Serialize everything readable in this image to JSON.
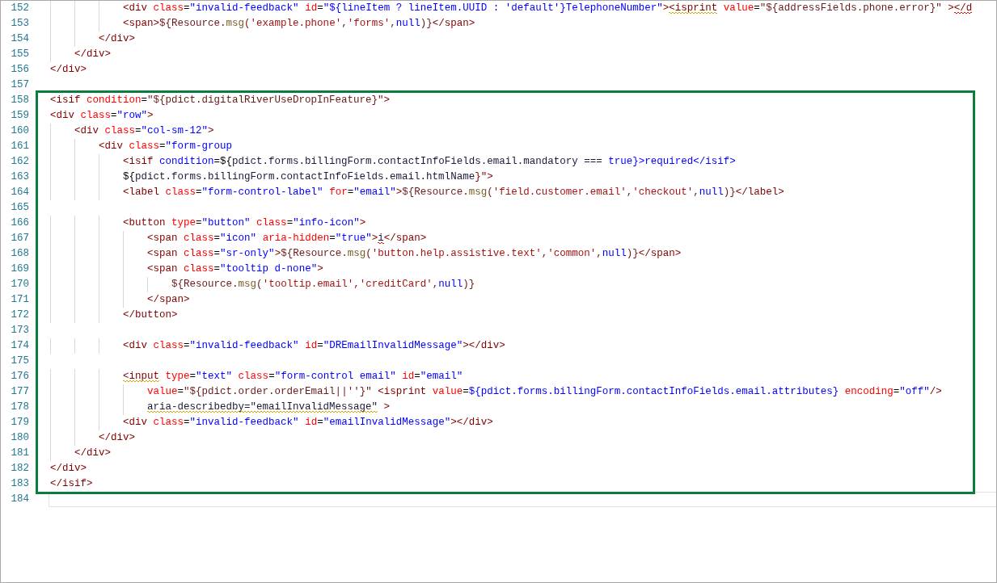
{
  "editor": {
    "groups": [
      {
        "highlighted": false,
        "lines": [
          {
            "number": "152",
            "current": false,
            "tokens": [
              {
                "kind": "tag",
                "text": "            <div"
              },
              {
                "kind": "attr",
                "text": " class"
              },
              {
                "kind": "punct",
                "text": "="
              },
              {
                "kind": "value",
                "text": "\"invalid-feedback\""
              },
              {
                "kind": "attr",
                "text": " id"
              },
              {
                "kind": "punct",
                "text": "="
              },
              {
                "kind": "value",
                "text": "\"${lineItem ? lineItem.UUID : 'default'}TelephoneNumber\""
              },
              {
                "kind": "tag",
                "text": ">"
              },
              {
                "kind": "tag",
                "text": "<isprint",
                "color": "#d6a800"
              },
              {
                "kind": "attr",
                "text": " value"
              },
              {
                "kind": "punct",
                "text": "="
              },
              {
                "kind": "expr",
                "text": "\"${addressFields.phone.error}\""
              },
              {
                "kind": "tag",
                "text": " >"
              },
              {
                "kind": "tag",
                "text": "</d",
                "color": "#e51400"
              }
            ]
          },
          {
            "number": "153",
            "current": false,
            "tokens": [
              {
                "kind": "tag",
                "text": "            <span>"
              },
              {
                "kind": "expr",
                "text": "${Resource."
              },
              {
                "kind": "func",
                "text": "msg"
              },
              {
                "kind": "expr",
                "text": "("
              },
              {
                "kind": "string",
                "text": "'example.phone'"
              },
              {
                "kind": "expr",
                "text": ","
              },
              {
                "kind": "string",
                "text": "'forms'"
              },
              {
                "kind": "expr",
                "text": ","
              },
              {
                "kind": "keyword",
                "text": "null"
              },
              {
                "kind": "expr",
                "text": ")}"
              },
              {
                "kind": "tag",
                "text": "</span>"
              }
            ]
          },
          {
            "number": "154",
            "current": false,
            "tokens": [
              {
                "kind": "tag",
                "text": "        </div>"
              }
            ]
          },
          {
            "number": "155",
            "current": false,
            "tokens": [
              {
                "kind": "tag",
                "text": "    </div>"
              }
            ]
          },
          {
            "number": "156",
            "current": false,
            "tokens": [
              {
                "kind": "tag",
                "text": "</div>"
              }
            ]
          },
          {
            "number": "157",
            "current": false
          }
        ]
      },
      {
        "highlighted": true,
        "lines": [
          {
            "number": "158",
            "current": false,
            "tokens": [
              {
                "kind": "tag",
                "text": "<isif"
              },
              {
                "kind": "attr",
                "text": " condition"
              },
              {
                "kind": "punct",
                "text": "="
              },
              {
                "kind": "expr",
                "text": "\"${pdict.digitalRiverUseDropInFeature}\""
              },
              {
                "kind": "tag",
                "text": ">"
              }
            ]
          },
          {
            "number": "159",
            "current": false,
            "tokens": [
              {
                "kind": "tag",
                "text": "<div"
              },
              {
                "kind": "attr",
                "text": " class"
              },
              {
                "kind": "punct",
                "text": "="
              },
              {
                "kind": "value",
                "text": "\"row\""
              },
              {
                "kind": "tag",
                "text": ">"
              }
            ]
          },
          {
            "number": "160",
            "current": false,
            "tokens": [
              {
                "kind": "tag",
                "text": "    <div"
              },
              {
                "kind": "attr",
                "text": " class"
              },
              {
                "kind": "punct",
                "text": "="
              },
              {
                "kind": "value",
                "text": "\"col-sm-12\""
              },
              {
                "kind": "tag",
                "text": ">"
              }
            ]
          },
          {
            "number": "161",
            "current": false,
            "tokens": [
              {
                "kind": "tag",
                "text": "        <div"
              },
              {
                "kind": "attr",
                "text": " class"
              },
              {
                "kind": "punct",
                "text": "="
              },
              {
                "kind": "value",
                "text": "\"form-group"
              }
            ]
          },
          {
            "number": "162",
            "current": false,
            "tokens": [
              {
                "kind": "tag",
                "text": "            <isif"
              },
              {
                "kind": "value",
                "text": " condition"
              },
              {
                "kind": "punct",
                "text": "=${"
              },
              {
                "kind": "plain",
                "text": "pdict.forms.billingForm.contactInfoFields.email.mandatory === "
              },
              {
                "kind": "keyword",
                "text": "true"
              },
              {
                "kind": "value",
                "text": "}>required</isif>"
              }
            ]
          },
          {
            "number": "163",
            "current": false,
            "tokens": [
              {
                "kind": "punct",
                "text": "            ${"
              },
              {
                "kind": "plain",
                "text": "pdict.forms.billingForm.contactInfoFields.email.htmlName"
              },
              {
                "kind": "tag",
                "text": "}\">"
              }
            ]
          },
          {
            "number": "164",
            "current": false,
            "tokens": [
              {
                "kind": "tag",
                "text": "            <label"
              },
              {
                "kind": "attr",
                "text": " class"
              },
              {
                "kind": "punct",
                "text": "="
              },
              {
                "kind": "value",
                "text": "\"form-control-label\""
              },
              {
                "kind": "attr",
                "text": " for"
              },
              {
                "kind": "punct",
                "text": "="
              },
              {
                "kind": "value",
                "text": "\"email\""
              },
              {
                "kind": "tag",
                "text": ">"
              },
              {
                "kind": "expr",
                "text": "${Resource."
              },
              {
                "kind": "func",
                "text": "msg"
              },
              {
                "kind": "expr",
                "text": "("
              },
              {
                "kind": "string",
                "text": "'field.customer.email'"
              },
              {
                "kind": "expr",
                "text": ","
              },
              {
                "kind": "string",
                "text": "'checkout'"
              },
              {
                "kind": "expr",
                "text": ","
              },
              {
                "kind": "keyword",
                "text": "null"
              },
              {
                "kind": "expr",
                "text": ")}"
              },
              {
                "kind": "tag",
                "text": "</label>"
              }
            ]
          },
          {
            "number": "165",
            "current": false
          },
          {
            "number": "166",
            "current": false,
            "tokens": [
              {
                "kind": "tag",
                "text": "            <button"
              },
              {
                "kind": "attr",
                "text": " type"
              },
              {
                "kind": "punct",
                "text": "="
              },
              {
                "kind": "value",
                "text": "\"button\""
              },
              {
                "kind": "attr",
                "text": " class"
              },
              {
                "kind": "punct",
                "text": "="
              },
              {
                "kind": "value",
                "text": "\"info-icon\""
              },
              {
                "kind": "tag",
                "text": ">"
              }
            ]
          },
          {
            "number": "167",
            "current": false,
            "tokens": [
              {
                "kind": "tag",
                "text": "                <span"
              },
              {
                "kind": "attr",
                "text": " class"
              },
              {
                "kind": "punct",
                "text": "="
              },
              {
                "kind": "value",
                "text": "\"icon\""
              },
              {
                "kind": "attr",
                "text": " aria-hidden"
              },
              {
                "kind": "punct",
                "text": "="
              },
              {
                "kind": "value",
                "text": "\"true\""
              },
              {
                "kind": "tag",
                "text": ">"
              },
              {
                "kind": "plain",
                "text": "i",
                "color": "#e51400"
              },
              {
                "kind": "tag",
                "text": "</span>"
              }
            ]
          },
          {
            "number": "168",
            "current": false,
            "tokens": [
              {
                "kind": "tag",
                "text": "                <span"
              },
              {
                "kind": "attr",
                "text": " class"
              },
              {
                "kind": "punct",
                "text": "="
              },
              {
                "kind": "value",
                "text": "\"sr-only\""
              },
              {
                "kind": "tag",
                "text": ">"
              },
              {
                "kind": "expr",
                "text": "${Resource."
              },
              {
                "kind": "func",
                "text": "msg"
              },
              {
                "kind": "expr",
                "text": "("
              },
              {
                "kind": "string",
                "text": "'button.help.assistive.text'"
              },
              {
                "kind": "expr",
                "text": ","
              },
              {
                "kind": "string",
                "text": "'common'"
              },
              {
                "kind": "expr",
                "text": ","
              },
              {
                "kind": "keyword",
                "text": "null"
              },
              {
                "kind": "expr",
                "text": ")}"
              },
              {
                "kind": "tag",
                "text": "</span>"
              }
            ]
          },
          {
            "number": "169",
            "current": false,
            "tokens": [
              {
                "kind": "tag",
                "text": "                <span"
              },
              {
                "kind": "attr",
                "text": " class"
              },
              {
                "kind": "punct",
                "text": "="
              },
              {
                "kind": "value",
                "text": "\"tooltip d-none\""
              },
              {
                "kind": "tag",
                "text": ">"
              }
            ]
          },
          {
            "number": "170",
            "current": false,
            "tokens": [
              {
                "kind": "expr",
                "text": "                    ${Resource."
              },
              {
                "kind": "func",
                "text": "msg"
              },
              {
                "kind": "expr",
                "text": "("
              },
              {
                "kind": "string",
                "text": "'tooltip.email'"
              },
              {
                "kind": "expr",
                "text": ","
              },
              {
                "kind": "string",
                "text": "'creditCard'"
              },
              {
                "kind": "expr",
                "text": ","
              },
              {
                "kind": "keyword",
                "text": "null"
              },
              {
                "kind": "expr",
                "text": ")}"
              }
            ]
          },
          {
            "number": "171",
            "current": false,
            "tokens": [
              {
                "kind": "tag",
                "text": "                </span>"
              }
            ]
          },
          {
            "number": "172",
            "current": false,
            "tokens": [
              {
                "kind": "tag",
                "text": "            </button>"
              }
            ]
          },
          {
            "number": "173",
            "current": false
          },
          {
            "number": "174",
            "current": false,
            "tokens": [
              {
                "kind": "tag",
                "text": "            <div"
              },
              {
                "kind": "attr",
                "text": " class"
              },
              {
                "kind": "punct",
                "text": "="
              },
              {
                "kind": "value",
                "text": "\"invalid-feedback\""
              },
              {
                "kind": "attr",
                "text": " id"
              },
              {
                "kind": "punct",
                "text": "="
              },
              {
                "kind": "value",
                "text": "\"DREmailInvalidMessage\""
              },
              {
                "kind": "tag",
                "text": "></div>"
              }
            ]
          },
          {
            "number": "175",
            "current": false
          },
          {
            "number": "176",
            "current": false,
            "tokens": [
              {
                "kind": "tag",
                "text": "            <input",
                "color": "#d6a800"
              },
              {
                "kind": "attr",
                "text": " type"
              },
              {
                "kind": "punct",
                "text": "="
              },
              {
                "kind": "value",
                "text": "\"text\""
              },
              {
                "kind": "attr",
                "text": " class"
              },
              {
                "kind": "punct",
                "text": "="
              },
              {
                "kind": "value",
                "text": "\"form-control email\""
              },
              {
                "kind": "attr",
                "text": " id"
              },
              {
                "kind": "punct",
                "text": "="
              },
              {
                "kind": "value",
                "text": "\"email\""
              }
            ]
          },
          {
            "number": "177",
            "current": false,
            "tokens": [
              {
                "kind": "attr",
                "text": "                value"
              },
              {
                "kind": "punct",
                "text": "="
              },
              {
                "kind": "expr",
                "text": "\"${pdict.order.orderEmail||''}\""
              },
              {
                "kind": "tag",
                "text": " <isprint"
              },
              {
                "kind": "attr",
                "text": " value"
              },
              {
                "kind": "punct",
                "text": "="
              },
              {
                "kind": "value",
                "text": "${pdict.forms.billingForm.contactInfoFields.email.attributes}"
              },
              {
                "kind": "attr",
                "text": " encoding"
              },
              {
                "kind": "punct",
                "text": "="
              },
              {
                "kind": "value",
                "text": "\"off\""
              },
              {
                "kind": "tag",
                "text": "/>"
              }
            ]
          },
          {
            "number": "178",
            "current": false,
            "tokens": [
              {
                "kind": "plain",
                "text": "                aria-describedby=\"emailInvalidMessage\"",
                "color": "#d6a800"
              },
              {
                "kind": "tag",
                "text": " >"
              }
            ]
          },
          {
            "number": "179",
            "current": false,
            "tokens": [
              {
                "kind": "tag",
                "text": "            <div"
              },
              {
                "kind": "attr",
                "text": " class"
              },
              {
                "kind": "punct",
                "text": "="
              },
              {
                "kind": "value",
                "text": "\"invalid-feedback\""
              },
              {
                "kind": "attr",
                "text": " id"
              },
              {
                "kind": "punct",
                "text": "="
              },
              {
                "kind": "value",
                "text": "\"emailInvalidMessage\""
              },
              {
                "kind": "tag",
                "text": "></div>"
              }
            ]
          },
          {
            "number": "180",
            "current": false,
            "tokens": [
              {
                "kind": "tag",
                "text": "        </div>"
              }
            ]
          },
          {
            "number": "181",
            "current": false,
            "tokens": [
              {
                "kind": "tag",
                "text": "    </div>"
              }
            ]
          },
          {
            "number": "182",
            "current": false,
            "tokens": [
              {
                "kind": "tag",
                "text": "</div>"
              }
            ]
          },
          {
            "number": "183",
            "current": false,
            "tokens": [
              {
                "kind": "tag",
                "text": "</isif>"
              }
            ]
          }
        ]
      },
      {
        "highlighted": false,
        "lines": [
          {
            "number": "184",
            "current": true
          }
        ]
      }
    ]
  }
}
